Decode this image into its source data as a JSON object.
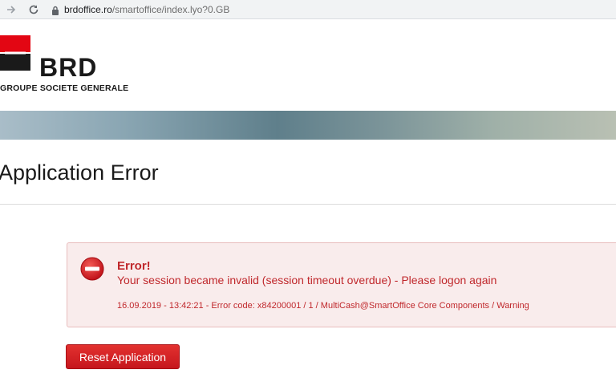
{
  "browser": {
    "url_host": "brdoffice.ro",
    "url_path": "/smartoffice/index.lyo?0.GB"
  },
  "header": {
    "logo_text": "BRD",
    "logo_subtitle": "GROUPE SOCIETE GENERALE"
  },
  "page": {
    "title": "Application Error"
  },
  "error": {
    "heading": "Error!",
    "message": "Your session became invalid (session timeout overdue) - Please logon again",
    "detail": "16.09.2019 - 13:42:21 - Error code: x84200001 / 1 / MultiCash@SmartOffice Core Components / Warning"
  },
  "actions": {
    "reset_label": "Reset Application"
  },
  "colors": {
    "brand_red": "#e30613",
    "error_text": "#c0282c",
    "error_bg": "#f9ecec"
  },
  "icons": [
    "back-arrow-icon",
    "forward-arrow-icon",
    "reload-icon",
    "lock-icon",
    "error-stop-icon"
  ]
}
